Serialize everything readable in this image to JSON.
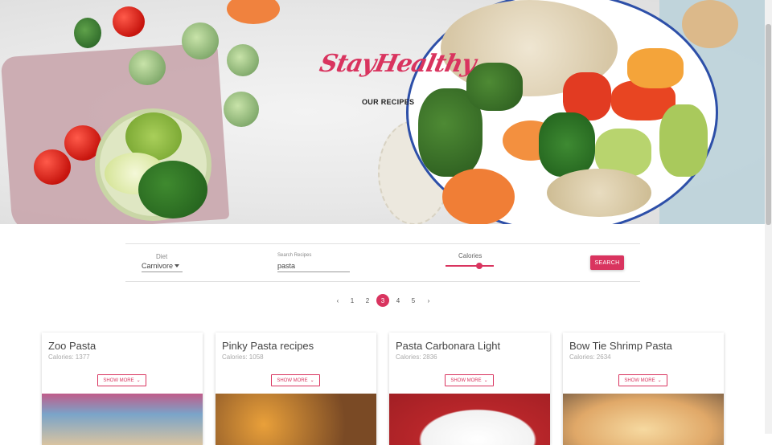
{
  "hero": {
    "brand": "StayHealthy",
    "nav_link": "OUR RECIPES"
  },
  "filters": {
    "diet_label": "Diet",
    "diet_value": "Carnivore",
    "search_label": "Search Recipes",
    "search_value": "pasta",
    "calories_label": "Calories",
    "calories_level": 0.7,
    "search_button": "SEARCH"
  },
  "pagination": {
    "prev": "‹",
    "next": "›",
    "pages": [
      "1",
      "2",
      "3",
      "4",
      "5"
    ],
    "current": "3"
  },
  "cards": [
    {
      "title": "Zoo Pasta",
      "calories": "Calories: 1377",
      "button": "SHOW MORE"
    },
    {
      "title": "Pinky Pasta recipes",
      "calories": "Calories: 1058",
      "button": "SHOW MORE"
    },
    {
      "title": "Pasta Carbonara Light",
      "calories": "Calories: 2836",
      "button": "SHOW MORE"
    },
    {
      "title": "Bow Tie Shrimp Pasta",
      "calories": "Calories: 2634",
      "button": "SHOW MORE"
    }
  ],
  "colors": {
    "accent": "#d9345f"
  }
}
